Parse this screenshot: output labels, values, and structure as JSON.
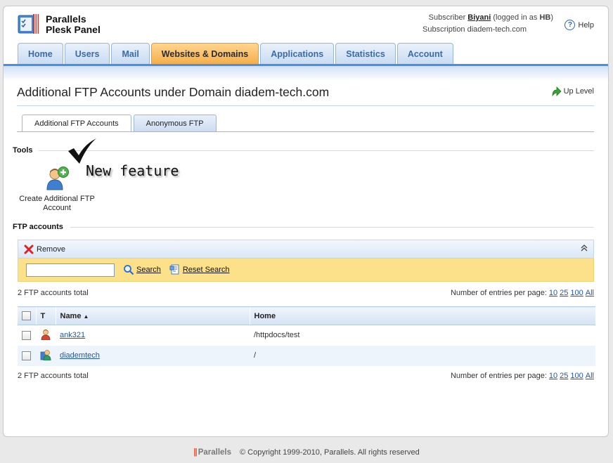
{
  "header": {
    "logo_line1": "Parallels",
    "logo_line2": "Plesk Panel",
    "subscriber_prefix": "Subscriber",
    "subscriber_name": "Biyani",
    "logged_in_prefix": "(logged in as",
    "logged_in_user": "HB",
    "logged_in_suffix": ")",
    "subscription_prefix": "Subscription",
    "subscription_domain": "diadem-tech.com",
    "help_label": "Help"
  },
  "nav": {
    "tabs": [
      {
        "label": "Home"
      },
      {
        "label": "Users"
      },
      {
        "label": "Mail"
      },
      {
        "label": "Websites & Domains",
        "active": true
      },
      {
        "label": "Applications"
      },
      {
        "label": "Statistics"
      },
      {
        "label": "Account"
      }
    ]
  },
  "page": {
    "title": "Additional FTP Accounts under Domain diadem-tech.com",
    "up_level": "Up Level",
    "subtabs": [
      {
        "label": "Additional FTP Accounts",
        "active": true
      },
      {
        "label": "Anonymous FTP"
      }
    ]
  },
  "tools": {
    "section_label": "Tools",
    "create_label_line1": "Create Additional FTP",
    "create_label_line2": "Account",
    "annotation": "New feature"
  },
  "ftp": {
    "section_label": "FTP accounts",
    "remove_label": "Remove",
    "search_value": "",
    "search_label": "Search",
    "reset_search_label": "Reset Search",
    "total_text": "2 FTP accounts total",
    "per_page_label": "Number of entries per page:",
    "per_page_options": [
      "10",
      "25",
      "100",
      "All"
    ],
    "columns": {
      "type": "T",
      "name": "Name",
      "sort_indicator": "▲",
      "home": "Home"
    },
    "rows": [
      {
        "name": "ank321",
        "home": "/httpdocs/test",
        "icon": "user-ftp-icon"
      },
      {
        "name": "diademtech",
        "home": "/",
        "icon": "system-user-ftp-icon"
      }
    ]
  },
  "footer": {
    "brand": "Parallels",
    "copyright": "© Copyright 1999-2010, Parallels. All rights reserved"
  },
  "colors": {
    "active_tab": "#f6ae49",
    "nav_tab_text": "#3c6aa6",
    "link": "#2456a3",
    "search_bar": "#fce18a"
  }
}
